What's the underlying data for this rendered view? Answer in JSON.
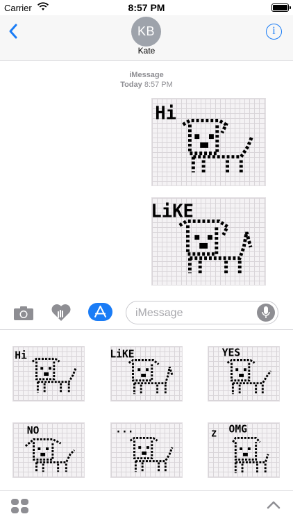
{
  "status_bar": {
    "carrier": "Carrier",
    "time": "8:57 PM",
    "wifi_icon": "wifi-icon",
    "battery_icon": "battery-icon",
    "battery_level": 1.0
  },
  "header": {
    "back_icon": "chevron-left-icon",
    "avatar_initials": "KB",
    "contact_name": "Kate",
    "info_icon": "info-icon",
    "info_glyph": "i"
  },
  "conversation": {
    "service": "iMessage",
    "day": "Today",
    "time": "8:57 PM",
    "messages": [
      {
        "sticker_caption": "Hi"
      },
      {
        "sticker_caption": "LiKE"
      }
    ]
  },
  "input_bar": {
    "camera_icon": "camera-icon",
    "digital_touch_icon": "heart-touch-icon",
    "app_store_icon": "app-store-icon",
    "placeholder": "iMessage",
    "mic_icon": "microphone-icon"
  },
  "drawer": {
    "stickers": [
      {
        "caption": "Hi"
      },
      {
        "caption": "LiKE"
      },
      {
        "caption": "YES"
      },
      {
        "caption": "NO"
      },
      {
        "caption": "..."
      },
      {
        "caption": "OMG"
      }
    ]
  },
  "bottom_bar": {
    "apps_icon": "app-drawer-icon",
    "expand_icon": "chevron-up-icon"
  },
  "colors": {
    "accent": "#1a7cf6",
    "avatar": "#9ea3ab",
    "header_bg": "#f7f7f7",
    "grey_text": "#8e8e93"
  }
}
